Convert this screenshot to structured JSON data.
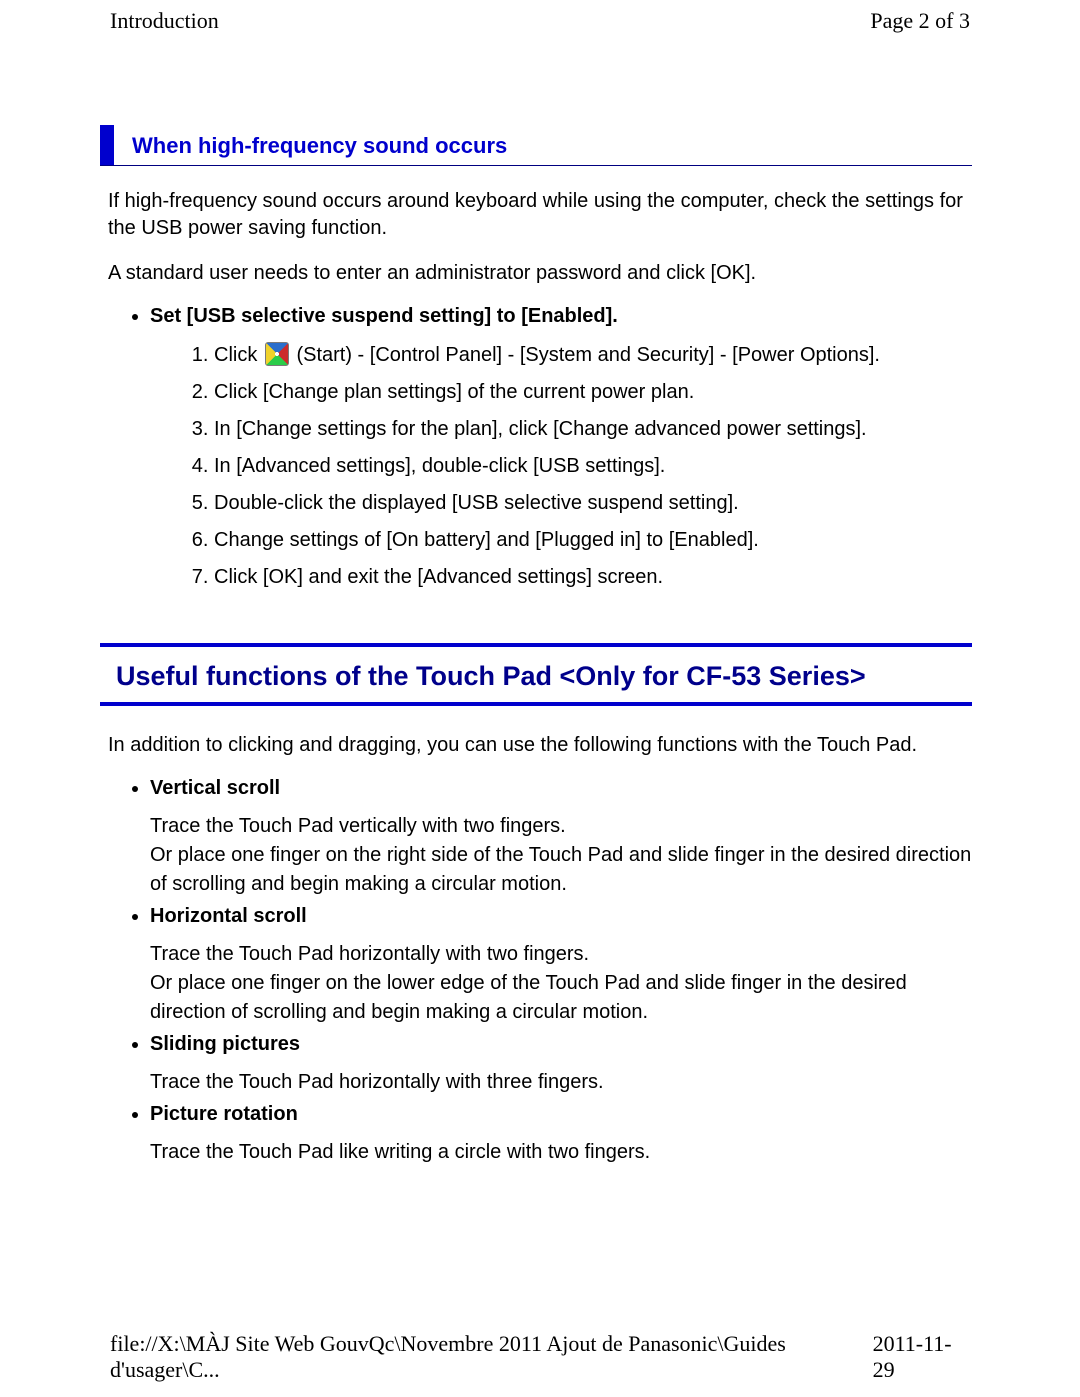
{
  "header": {
    "title": "Introduction",
    "page_indicator": "Page 2 of 3"
  },
  "section1": {
    "heading": "When high-frequency sound occurs",
    "para1": "If high-frequency sound occurs around keyboard while using the computer, check the settings for the USB power saving function.",
    "para2": "A standard user needs to enter an administrator password and click [OK].",
    "bullet_head": "Set [USB selective suspend setting] to [Enabled].",
    "step1_a": "Click ",
    "step1_b": " (Start) - [Control Panel] - [System and Security] - [Power Options].",
    "step2": "Click [Change plan settings] of the current power plan.",
    "step3": "In [Change settings for the plan], click [Change advanced power settings].",
    "step4": "In [Advanced settings], double-click [USB settings].",
    "step5": "Double-click the displayed [USB selective suspend setting].",
    "step6": "Change settings of [On battery] and [Plugged in] to [Enabled].",
    "step7": "Click [OK] and exit the [Advanced settings] screen."
  },
  "section2": {
    "heading": "Useful functions of the Touch Pad <Only for CF-53 Series>",
    "intro": "In addition to clicking and dragging, you can use the following functions with the Touch Pad.",
    "items": [
      {
        "title": "Vertical scroll",
        "body": "Trace the Touch Pad vertically with two fingers.\nOr place one finger on the right side of the Touch Pad and slide finger in the desired direction of scrolling and begin making a circular motion."
      },
      {
        "title": "Horizontal scroll",
        "body": "Trace the Touch Pad horizontally with two fingers.\nOr place one finger on the lower edge of the Touch Pad and slide finger in the desired direction of scrolling and begin making a circular motion."
      },
      {
        "title": "Sliding pictures",
        "body": "Trace the Touch Pad horizontally with three fingers."
      },
      {
        "title": "Picture rotation",
        "body": "Trace the Touch Pad like writing a circle with two fingers."
      }
    ]
  },
  "footer": {
    "path": "file://X:\\MÀJ Site Web GouvQc\\Novembre 2011 Ajout de Panasonic\\Guides d'usager\\C...",
    "date": "2011-11-29"
  }
}
